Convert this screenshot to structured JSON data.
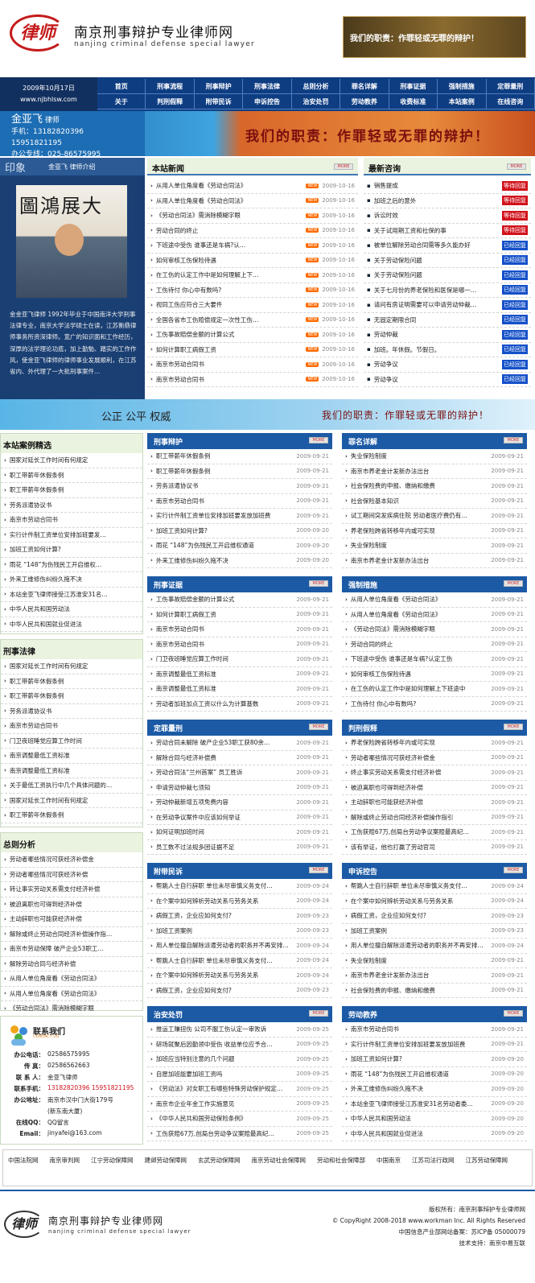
{
  "header": {
    "logo_text": "律师",
    "site_name": "南京刑事辩护专业律师网",
    "site_sub": "nanjing criminal defense special lawyer",
    "banner_text": "我们的职责：作罪轻或无罪的辩护！"
  },
  "date_box": {
    "date": "2009年10月17日",
    "domain": "www.njbhlsw.com"
  },
  "nav": {
    "row1": [
      "首页",
      "刑事流程",
      "刑事辩护",
      "刑事法律",
      "总则分析",
      "罪名详解",
      "刑事证据",
      "强制措施",
      "定罪量刑"
    ],
    "row2": [
      "关于",
      "判刑假释",
      "附带民诉",
      "申诉控告",
      "治安处罚",
      "劳动教养",
      "收费标准",
      "本站案例",
      "在线咨询"
    ]
  },
  "band": {
    "name": "金亚飞",
    "role": "律师",
    "phone_label": "手机：",
    "phone": "13182820396 15951821195",
    "office_label": "办公专线：",
    "office": "025-86575995",
    "slogan": "我们的职责：作罪轻或无罪的辩护！"
  },
  "profile": {
    "tab_title": "印象",
    "tab_sub": "金亚飞 律师介绍",
    "bio": "金金亚飞律师 1992年毕业于中国南洋大学刑事法律专业，南京大学法学硕士在读，江苏衡鼎律师事务所资深律师。宽广的知识面和工作经历，深厚的法学理论功底，加上勤勉、踏实的工作作风，使金亚飞律师的律师事业发展顺利，在江苏省内、外代理了一大批刑事案件…"
  },
  "news": {
    "title": "本站新闻",
    "more": "MORE",
    "items": [
      {
        "t": "从用人单位角度看《劳动合同法》",
        "d": "2009-10-16"
      },
      {
        "t": "从用人单位角度看《劳动合同法》",
        "d": "2009-10-16"
      },
      {
        "t": "《劳动合同法》需消除模糊字眼",
        "d": "2009-10-16"
      },
      {
        "t": "劳动合同的终止",
        "d": "2009-10-16"
      },
      {
        "t": "下班途中受伤 谁事还是车祸?认…",
        "d": "2009-10-16"
      },
      {
        "t": "如何审核工伤保险待遇",
        "d": "2009-10-16"
      },
      {
        "t": "在工伤的认定工作中是如何理解上下…",
        "d": "2009-10-16"
      },
      {
        "t": "工伤待付 你心中有数吗?",
        "d": "2009-10-16"
      },
      {
        "t": "视同工伤应符合三大要件",
        "d": "2009-10-16"
      },
      {
        "t": "全国各省市工伤赔偿规定一次性工伤…",
        "d": "2009-10-16"
      },
      {
        "t": "工伤事故赔偿金额的计算公式",
        "d": "2009-10-16"
      },
      {
        "t": "如何计算职工病假工资",
        "d": "2009-10-16"
      },
      {
        "t": "南京市劳动合同书",
        "d": "2009-10-16"
      },
      {
        "t": "南京市劳动合同书",
        "d": "2009-10-16"
      }
    ],
    "new_badge": "NEW"
  },
  "consult": {
    "title": "最新咨询",
    "more": "MORE",
    "items": [
      {
        "t": "销售提成",
        "s": "等待回复",
        "c": "r"
      },
      {
        "t": "加班之后的意外",
        "s": "等待回复",
        "c": "r"
      },
      {
        "t": "诉讼时效",
        "s": "等待回复",
        "c": "r"
      },
      {
        "t": "关于试用期工资和社保的事",
        "s": "等待回复",
        "c": "r"
      },
      {
        "t": "被单位解除劳动合同需等多久能办好",
        "s": "已经回复",
        "c": "b"
      },
      {
        "t": "关于劳动保险问题",
        "s": "已经回复",
        "c": "b"
      },
      {
        "t": "关于劳动保险问题",
        "s": "已经回复",
        "c": "b"
      },
      {
        "t": "关于七月份的养老保险和医保是哪一…",
        "s": "已经回复",
        "c": "b"
      },
      {
        "t": "请问有房证明需要可以申请劳动仲裁…",
        "s": "已经回复",
        "c": "b"
      },
      {
        "t": "无固定期限合同",
        "s": "已经回复",
        "c": "b"
      },
      {
        "t": "劳动仲裁",
        "s": "已经回复",
        "c": "b"
      },
      {
        "t": "加班。年休假。节假日。",
        "s": "已经回复",
        "c": "b"
      },
      {
        "t": "劳动争议",
        "s": "已经回复",
        "c": "b"
      },
      {
        "t": "劳动争议",
        "s": "已经回复",
        "c": "b"
      }
    ]
  },
  "strip": {
    "left": "公正 公平 权威",
    "right": "我们的职责：作罪轻或无罪的辩护！"
  },
  "left_lists": [
    {
      "title": "本站案例精选",
      "items": [
        "国家对延长工作时间有何规定",
        "职工带薪年休假条例",
        "职工带薪年休假条例",
        "劳务派遣协议书",
        "南京市劳动合同书",
        "实行计件制工资单位安排加班要发…",
        "加班工资如何计算?",
        "雨花 “148”为伤残民工开启维权…",
        "外来工维修伤纠纷久拖不决",
        "本站金亚飞律师接受江苏淮安31名…",
        "中华人民共和国劳动法",
        "中华人民共和国就业促进法"
      ]
    },
    {
      "title": "刑事法律",
      "items": [
        "国家对延长工作时间有何规定",
        "职工带薪年休假条例",
        "职工带薪年休假条例",
        "劳务派遣协议书",
        "南京市劳动合同书",
        "门卫夜班睡觉应算工作时间",
        "南京调整最低工资标准",
        "南京调整最低工资标准",
        "关于最低工资执行中几个具体问题的…",
        "国家对延长工作时间有何规定",
        "职工带薪年休假条例"
      ]
    },
    {
      "title": "总则分析",
      "items": [
        "劳动者哪些情况可获经济补偿金",
        "劳动者哪些情况可获经济补偿",
        "转让事实劳动关系需支付经济补偿",
        "被迫离职也可得到经济补偿",
        "主动辞职也可能获经济补偿",
        "解除或终止劳动合同经济补偿操作指…",
        "南京市劳动保障 破产企业53职工…",
        "解除劳动合同与经济补偿",
        "从用人单位角度看《劳动合同法》",
        "从用人单位角度看《劳动合同法》",
        "《劳动合同法》需消除模糊字眼"
      ]
    }
  ],
  "boxes": [
    {
      "title": "刑事辩护",
      "items": [
        [
          "职工带薪年休假条例",
          "2009-09-21"
        ],
        [
          "职工带薪年休假条例",
          "2009-09-21"
        ],
        [
          "劳务派遣协议书",
          "2009-09-21"
        ],
        [
          "南京市劳动合同书",
          "2009-09-21"
        ],
        [
          "实行计件制工资单位安排加班要发放加班费",
          "2009-09-21"
        ],
        [
          "加班工资如何计算?",
          "2009-09-20"
        ],
        [
          "雨花 “148”为伤残民工开启维权通道",
          "2009-09-20"
        ],
        [
          "外来工维修伤纠纷久拖不决",
          "2009-09-20"
        ]
      ]
    },
    {
      "title": "罪名详解",
      "items": [
        [
          "失业保险制度",
          "2009-09-21"
        ],
        [
          "南京市养老金计发新办法出台",
          "2009-09-21"
        ],
        [
          "社会保险费的申报、缴纳和缴费",
          "2009-09-21"
        ],
        [
          "社会保险基本知识",
          "2009-09-21"
        ],
        [
          "试工期间突发疾病住院 劳动者医疗费仍有…",
          "2009-09-21"
        ],
        [
          "养老保险跨省转移年内或可实现",
          "2009-09-21"
        ],
        [
          "失业保险制度",
          "2009-09-21"
        ],
        [
          "南京市养老金计发新办法出台",
          "2009-09-21"
        ]
      ]
    },
    {
      "title": "刑事证据",
      "items": [
        [
          "工伤事故赔偿金额的计算公式",
          "2009-09-21"
        ],
        [
          "如何计算职工病假工资",
          "2009-09-21"
        ],
        [
          "南京市劳动合同书",
          "2009-09-21"
        ],
        [
          "南京市劳动合同书",
          "2009-09-21"
        ],
        [
          "门卫夜班睡觉应算工作时间",
          "2009-09-21"
        ],
        [
          "南京调整最低工资标准",
          "2009-09-21"
        ],
        [
          "南京调整最低工资标准",
          "2009-09-21"
        ],
        [
          "劳动者加班加点工资以什么为计算基数",
          "2009-09-21"
        ]
      ]
    },
    {
      "title": "强制措施",
      "items": [
        [
          "从用人单位角度看《劳动合同法》",
          "2009-09-21"
        ],
        [
          "从用人单位角度看《劳动合同法》",
          "2009-09-21"
        ],
        [
          "《劳动合同法》需消除模糊字眼",
          "2009-09-21"
        ],
        [
          "劳动合同的终止",
          "2009-09-21"
        ],
        [
          "下班途中受伤 谁事还是车祸?认定工伤",
          "2009-09-21"
        ],
        [
          "如何审核工伤保险待遇",
          "2009-09-21"
        ],
        [
          "在工伤的认定工作中是如何理解上下班途中",
          "2009-09-21"
        ],
        [
          "工伤待付 你心中有数吗?",
          "2009-09-21"
        ]
      ]
    },
    {
      "title": "定罪量刑",
      "items": [
        [
          "劳动合同未解除 破产企业53职工获80余…",
          "2009-09-21"
        ],
        [
          "解除合同与经济补偿费",
          "2009-09-21"
        ],
        [
          "劳动合同法“兰州首案” 员工胜诉",
          "2009-09-21"
        ],
        [
          "申请劳动仲裁七须知",
          "2009-09-21"
        ],
        [
          "劳动仲裁新增五项免费内容",
          "2009-09-21"
        ],
        [
          "在劳动争议案件中应该如何举证",
          "2009-09-21"
        ],
        [
          "如何证明加班时间",
          "2009-09-21"
        ],
        [
          "员工数不过法规多团证据不足",
          "2009-09-21"
        ]
      ]
    },
    {
      "title": "判刑假释",
      "items": [
        [
          "养老保险跨省转移年内或可实现",
          "2009-09-21"
        ],
        [
          "劳动者哪些情况可获经济补偿金",
          "2009-09-21"
        ],
        [
          "终止事实劳动关系需支付经济补偿",
          "2009-09-21"
        ],
        [
          "被迫离职也可得到经济补偿",
          "2009-09-21"
        ],
        [
          "主动辞职也可能获经济补偿",
          "2009-09-21"
        ],
        [
          "解除或终止劳动合同经济补偿操作指引",
          "2009-09-21"
        ],
        [
          "工伤获赔67万,创局台劳动争议案赔最高纪…",
          "2009-09-21"
        ],
        [
          "该有举证，他也打赢了劳动官司",
          "2009-09-21"
        ]
      ]
    },
    {
      "title": "附带民诉",
      "items": [
        [
          "帮跳人士自行辞职 单位未尽审慎义务支付…",
          "2009-09-24"
        ],
        [
          "在个案中如何辨析劳动关系与劳务关系",
          "2009-09-24"
        ],
        [
          "病假工资，企业应如何支付?",
          "2009-09-23"
        ],
        [
          "加班工资案例",
          "2009-09-23"
        ],
        [
          "用人单位擅自解除派遣劳动者的职务并不再安排…",
          "2009-09-24"
        ],
        [
          "帮跳人士自行辞职 单位未尽审慎义务支付…",
          "2009-09-24"
        ],
        [
          "在个案中如何辨析劳动关系与劳务关系",
          "2009-09-24"
        ],
        [
          "病假工资，企业应如何支付?",
          "2009-09-23"
        ]
      ]
    },
    {
      "title": "申诉控告",
      "items": [
        [
          "帮跳人士自行辞职 单位未尽审慎义务支付…",
          "2009-09-24"
        ],
        [
          "在个案中如何辨析劳动关系与劳务关系",
          "2009-09-24"
        ],
        [
          "病假工资，企业应如何支付?",
          "2009-09-23"
        ],
        [
          "加班工资案例",
          "2009-09-23"
        ],
        [
          "用人单位擅自解除派遣劳动者的职务并不再安排…",
          "2009-09-24"
        ],
        [
          "失业保险制度",
          "2009-09-21"
        ],
        [
          "南京市养老金计发新办法出台",
          "2009-09-21"
        ],
        [
          "社会保险费的申报、缴纳和缴费",
          "2009-09-21"
        ]
      ]
    },
    {
      "title": "治安处罚",
      "items": [
        [
          "推运工赚扭伤 公司不服工伤认定一审败诉",
          "2009-09-25"
        ],
        [
          "研场就聚后因勤领中受伤 收益单位应予合…",
          "2009-09-25"
        ],
        [
          "加班应当特别注意的几个问题",
          "2009-09-25"
        ],
        [
          "自愿加班能要加班工资吗",
          "2009-09-25"
        ],
        [
          "《劳动法》对女职工有哪些特殊劳动保护规定…",
          "2009-09-25"
        ],
        [
          "南京市企业年金工作实施意见",
          "2009-09-25"
        ],
        [
          "《中华人民共和国劳动保险条例》",
          "2009-09-25"
        ],
        [
          "工伤获赔67万,创局台劳动争议案赔最高纪…",
          "2009-09-25"
        ]
      ]
    },
    {
      "title": "劳动教养",
      "items": [
        [
          "南京市劳动合同书",
          "2009-09-21"
        ],
        [
          "实行计件制工资单位安排加班要发放加班费",
          "2009-09-21"
        ],
        [
          "加班工资如何计算?",
          "2009-09-20"
        ],
        [
          "雨花 “148”为伤残民工开启维权通道",
          "2009-09-20"
        ],
        [
          "外来工维修伤纠纷久拖不决",
          "2009-09-20"
        ],
        [
          "本站金亚飞律师接受江苏淮安31名劳动者委…",
          "2009-09-20"
        ],
        [
          "中华人民共和国劳动法",
          "2009-09-20"
        ],
        [
          "中华人民共和国就业促进法",
          "2009-09-20"
        ]
      ]
    }
  ],
  "contact": {
    "title": "联系我们",
    "sub": "CONTACT US",
    "rows": [
      [
        "办公电话：",
        "02586575995"
      ],
      [
        "传  真：",
        "02586562663"
      ],
      [
        "联 系 人：",
        "金亚飞律师"
      ],
      [
        "联系手机：",
        "13182820396 15951821195"
      ],
      [
        "办公地址：",
        "南京市汉中门大街179号"
      ],
      [
        "",
        "(新东南大厦)"
      ],
      [
        "在线QQ：",
        "QQ留言"
      ],
      [
        "Email：",
        "jinyafei@163.com"
      ]
    ]
  },
  "links": [
    "中国法院网",
    "南京审判网",
    "江宁劳动保障网",
    "建邺劳动保障网",
    "玄武劳动保障网",
    "南京劳动社会保障网",
    "劳动和社会保障部",
    "中国南京",
    "江苏司法行政网",
    "江苏劳动保障网"
  ],
  "footer": {
    "logo_text": "律师",
    "name": "南京刑事辩护专业律师网",
    "sub": "nanjing criminal defense special lawyer",
    "lines": [
      "版权所有：南京刑事辩护专业律师网",
      "© CopyRight 2008-2018 www.workman Inc. All Rights Reserved",
      "中国信息产业部网站备案：苏ICP备 05000079",
      "技术支持：南京中易互联"
    ]
  }
}
